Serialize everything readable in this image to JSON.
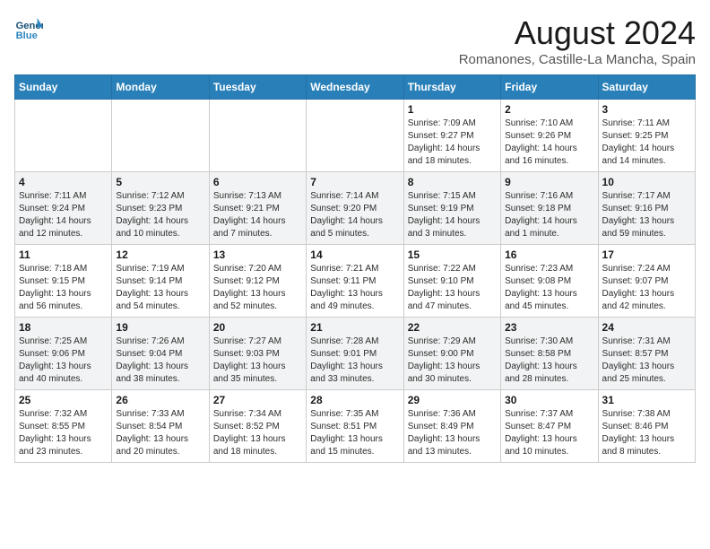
{
  "header": {
    "logo_line1": "General",
    "logo_line2": "Blue",
    "main_title": "August 2024",
    "subtitle": "Romanones, Castille-La Mancha, Spain"
  },
  "weekdays": [
    "Sunday",
    "Monday",
    "Tuesday",
    "Wednesday",
    "Thursday",
    "Friday",
    "Saturday"
  ],
  "weeks": [
    [
      {
        "day": "",
        "info": ""
      },
      {
        "day": "",
        "info": ""
      },
      {
        "day": "",
        "info": ""
      },
      {
        "day": "",
        "info": ""
      },
      {
        "day": "1",
        "info": "Sunrise: 7:09 AM\nSunset: 9:27 PM\nDaylight: 14 hours\nand 18 minutes."
      },
      {
        "day": "2",
        "info": "Sunrise: 7:10 AM\nSunset: 9:26 PM\nDaylight: 14 hours\nand 16 minutes."
      },
      {
        "day": "3",
        "info": "Sunrise: 7:11 AM\nSunset: 9:25 PM\nDaylight: 14 hours\nand 14 minutes."
      }
    ],
    [
      {
        "day": "4",
        "info": "Sunrise: 7:11 AM\nSunset: 9:24 PM\nDaylight: 14 hours\nand 12 minutes."
      },
      {
        "day": "5",
        "info": "Sunrise: 7:12 AM\nSunset: 9:23 PM\nDaylight: 14 hours\nand 10 minutes."
      },
      {
        "day": "6",
        "info": "Sunrise: 7:13 AM\nSunset: 9:21 PM\nDaylight: 14 hours\nand 7 minutes."
      },
      {
        "day": "7",
        "info": "Sunrise: 7:14 AM\nSunset: 9:20 PM\nDaylight: 14 hours\nand 5 minutes."
      },
      {
        "day": "8",
        "info": "Sunrise: 7:15 AM\nSunset: 9:19 PM\nDaylight: 14 hours\nand 3 minutes."
      },
      {
        "day": "9",
        "info": "Sunrise: 7:16 AM\nSunset: 9:18 PM\nDaylight: 14 hours\nand 1 minute."
      },
      {
        "day": "10",
        "info": "Sunrise: 7:17 AM\nSunset: 9:16 PM\nDaylight: 13 hours\nand 59 minutes."
      }
    ],
    [
      {
        "day": "11",
        "info": "Sunrise: 7:18 AM\nSunset: 9:15 PM\nDaylight: 13 hours\nand 56 minutes."
      },
      {
        "day": "12",
        "info": "Sunrise: 7:19 AM\nSunset: 9:14 PM\nDaylight: 13 hours\nand 54 minutes."
      },
      {
        "day": "13",
        "info": "Sunrise: 7:20 AM\nSunset: 9:12 PM\nDaylight: 13 hours\nand 52 minutes."
      },
      {
        "day": "14",
        "info": "Sunrise: 7:21 AM\nSunset: 9:11 PM\nDaylight: 13 hours\nand 49 minutes."
      },
      {
        "day": "15",
        "info": "Sunrise: 7:22 AM\nSunset: 9:10 PM\nDaylight: 13 hours\nand 47 minutes."
      },
      {
        "day": "16",
        "info": "Sunrise: 7:23 AM\nSunset: 9:08 PM\nDaylight: 13 hours\nand 45 minutes."
      },
      {
        "day": "17",
        "info": "Sunrise: 7:24 AM\nSunset: 9:07 PM\nDaylight: 13 hours\nand 42 minutes."
      }
    ],
    [
      {
        "day": "18",
        "info": "Sunrise: 7:25 AM\nSunset: 9:06 PM\nDaylight: 13 hours\nand 40 minutes."
      },
      {
        "day": "19",
        "info": "Sunrise: 7:26 AM\nSunset: 9:04 PM\nDaylight: 13 hours\nand 38 minutes."
      },
      {
        "day": "20",
        "info": "Sunrise: 7:27 AM\nSunset: 9:03 PM\nDaylight: 13 hours\nand 35 minutes."
      },
      {
        "day": "21",
        "info": "Sunrise: 7:28 AM\nSunset: 9:01 PM\nDaylight: 13 hours\nand 33 minutes."
      },
      {
        "day": "22",
        "info": "Sunrise: 7:29 AM\nSunset: 9:00 PM\nDaylight: 13 hours\nand 30 minutes."
      },
      {
        "day": "23",
        "info": "Sunrise: 7:30 AM\nSunset: 8:58 PM\nDaylight: 13 hours\nand 28 minutes."
      },
      {
        "day": "24",
        "info": "Sunrise: 7:31 AM\nSunset: 8:57 PM\nDaylight: 13 hours\nand 25 minutes."
      }
    ],
    [
      {
        "day": "25",
        "info": "Sunrise: 7:32 AM\nSunset: 8:55 PM\nDaylight: 13 hours\nand 23 minutes."
      },
      {
        "day": "26",
        "info": "Sunrise: 7:33 AM\nSunset: 8:54 PM\nDaylight: 13 hours\nand 20 minutes."
      },
      {
        "day": "27",
        "info": "Sunrise: 7:34 AM\nSunset: 8:52 PM\nDaylight: 13 hours\nand 18 minutes."
      },
      {
        "day": "28",
        "info": "Sunrise: 7:35 AM\nSunset: 8:51 PM\nDaylight: 13 hours\nand 15 minutes."
      },
      {
        "day": "29",
        "info": "Sunrise: 7:36 AM\nSunset: 8:49 PM\nDaylight: 13 hours\nand 13 minutes."
      },
      {
        "day": "30",
        "info": "Sunrise: 7:37 AM\nSunset: 8:47 PM\nDaylight: 13 hours\nand 10 minutes."
      },
      {
        "day": "31",
        "info": "Sunrise: 7:38 AM\nSunset: 8:46 PM\nDaylight: 13 hours\nand 8 minutes."
      }
    ]
  ]
}
